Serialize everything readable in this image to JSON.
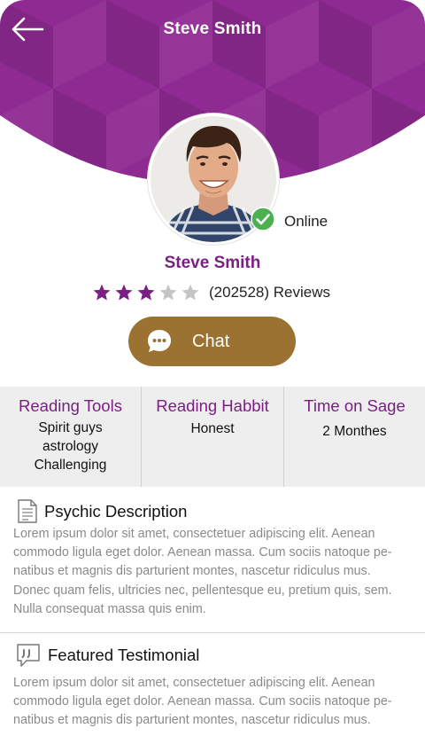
{
  "header": {
    "title": "Steve Smith",
    "back_icon": "arrow-left-icon",
    "color": "#8e2a91"
  },
  "profile": {
    "name": "Steve Smith",
    "status": "Online",
    "status_icon": "checkmark-badge-icon",
    "status_color": "#4caf50",
    "rating": 3,
    "rating_max": 5,
    "reviews_text": "(202528) Reviews",
    "accent_color": "#7b1f84"
  },
  "chat_button": {
    "label": "Chat",
    "icon": "chat-bubble-icon",
    "color": "#9b7232"
  },
  "info": [
    {
      "title": "Reading Tools",
      "values": [
        "Spirit  guys",
        "astrology",
        "Challenging"
      ]
    },
    {
      "title": "Reading Habbit",
      "values": [
        "Honest"
      ]
    },
    {
      "title": "Time on Sage",
      "values": [
        "2 Monthes"
      ]
    }
  ],
  "sections": {
    "description": {
      "title": "Psychic Description",
      "icon": "document-icon",
      "lines": [
        "Lorem ipsum dolor sit amet, consectetuer adipiscing elit. Aenean",
        "commodo ligula eget dolor. Aenean massa. Cum sociis natoque pe-",
        "natibus et magnis dis parturient montes, nascetur ridiculus mus.",
        "Donec quam felis, ultricies nec, pellentesque eu, pretium quis, sem.",
        "Nulla consequat massa quis enim."
      ]
    },
    "testimonial": {
      "title": "Featured Testimonial",
      "icon": "quote-bubble-icon",
      "lines": [
        "Lorem ipsum dolor sit amet, consectetuer adipiscing elit. Aenean",
        "commodo ligula eget dolor. Aenean massa. Cum sociis natoque pe-",
        "natibus et magnis dis parturient montes, nascetur ridiculus mus."
      ]
    }
  }
}
